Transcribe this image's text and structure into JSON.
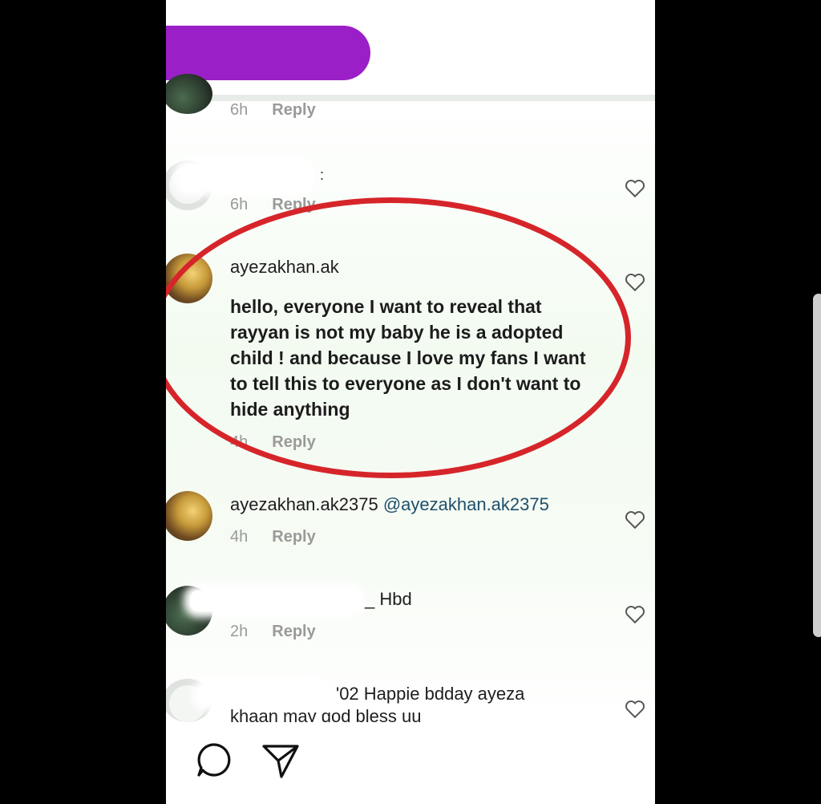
{
  "comments": [
    {
      "time": "6h",
      "reply": "Reply"
    },
    {
      "time": "6h",
      "reply": "Reply",
      "partial": ":"
    },
    {
      "username": "ayezakhan.ak",
      "text": "hello, everyone I want to reveal that rayyan is not my baby he is a adopted child ! and because I love my fans I want to tell this to everyone as I don't want to hide anything",
      "time": "4h",
      "reply": "Reply"
    },
    {
      "username": "ayezakhan.ak2375",
      "mention": "@ayezakhan.ak2375",
      "time": "4h",
      "reply": "Reply"
    },
    {
      "text": "_ Hbd",
      "time": "2h",
      "reply": "Reply"
    },
    {
      "text_line1": "'02 Happie bdday ayeza",
      "text_line2": "khaan may god bless uu"
    }
  ],
  "colors": {
    "highlight": "#d6252a",
    "redaction": "#9b1fc6"
  },
  "icons": {
    "comment": "comment-icon",
    "share": "share-icon",
    "like": "heart-icon"
  }
}
